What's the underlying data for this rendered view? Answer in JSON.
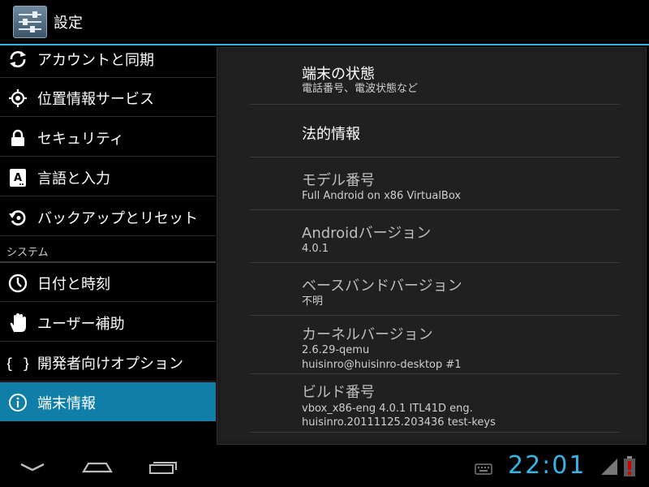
{
  "app": {
    "title": "設定"
  },
  "menu": {
    "items": [
      {
        "label": "アカウントと同期",
        "icon": "sync-icon"
      },
      {
        "label": "位置情報サービス",
        "icon": "location-icon"
      },
      {
        "label": "セキュリティ",
        "icon": "lock-icon"
      },
      {
        "label": "言語と入力",
        "icon": "language-icon"
      },
      {
        "label": "バックアップとリセット",
        "icon": "backup-icon"
      }
    ],
    "section_header": "システム",
    "system_items": [
      {
        "label": "日付と時刻",
        "icon": "clock-icon"
      },
      {
        "label": "ユーザー補助",
        "icon": "hand-icon"
      },
      {
        "label": "開発者向けオプション",
        "icon": "braces-icon"
      },
      {
        "label": "端末情報",
        "icon": "info-icon",
        "selected": true
      }
    ]
  },
  "about": {
    "rows": [
      {
        "title": "端末の状態",
        "lines": [
          "電話番号、電波状態など"
        ]
      },
      {
        "title": "法的情報",
        "lines": []
      },
      {
        "title": "モデル番号",
        "lines": [
          "Full Android on x86 VirtualBox"
        ]
      },
      {
        "title": "Androidバージョン",
        "lines": [
          "4.0.1"
        ]
      },
      {
        "title": "ベースバンドバージョン",
        "lines": [
          "不明"
        ]
      },
      {
        "title": "カーネルバージョン",
        "lines": [
          "2.6.29-qemu",
          "huisinro@huisinro-desktop #1"
        ]
      },
      {
        "title": "ビルド番号",
        "lines": [
          "vbox_x86-eng 4.0.1 ITL41D eng.",
          "huisinro.20111125.203436 test-keys"
        ]
      }
    ]
  },
  "statusbar": {
    "time": "22:01"
  },
  "colors": {
    "accent": "#33b5e5",
    "selected": "#0f7ea8",
    "battery_alert": "#cc0000"
  }
}
